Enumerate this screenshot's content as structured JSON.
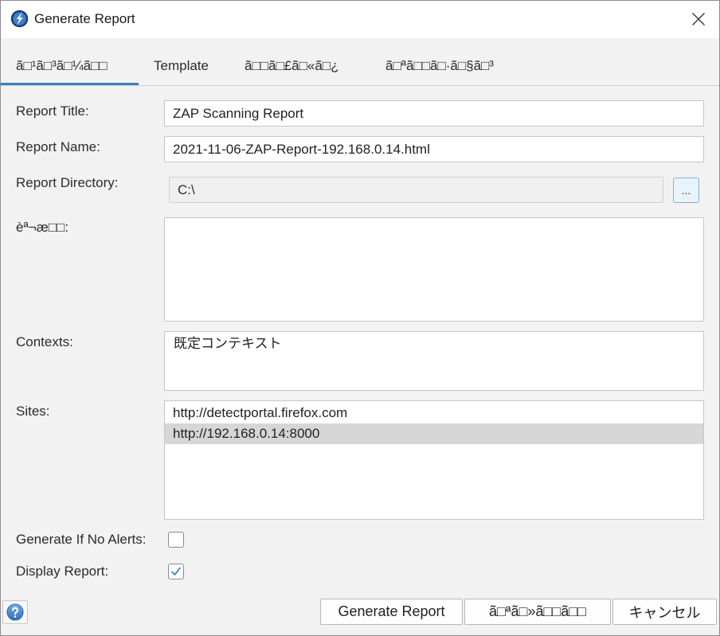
{
  "window": {
    "title": "Generate Report"
  },
  "tabs": [
    {
      "label": "ã□¹ã□³ã□¼ã□□",
      "selected": true
    },
    {
      "label": "Template",
      "selected": false
    },
    {
      "label": "ã□□ã□£ã□«ã□¿",
      "selected": false
    },
    {
      "label": "ã□ªã□□ã□·ã□§ã□³",
      "selected": false
    }
  ],
  "form": {
    "report_title": {
      "label": "Report Title:",
      "value": "ZAP Scanning Report"
    },
    "report_name": {
      "label": "Report Name:",
      "value": "2021-11-06-ZAP-Report-192.168.0.14.html"
    },
    "report_directory": {
      "label": "Report Directory:",
      "value": "C:\\",
      "browse_label": "...",
      "disabled": true
    },
    "description": {
      "label": "èª¬æ□□:"
    },
    "contexts": {
      "label": "Contexts:",
      "items": [
        "既定コンテキスト"
      ]
    },
    "sites": {
      "label": "Sites:",
      "items": [
        {
          "url": "http://detectportal.firefox.com",
          "selected": false
        },
        {
          "url": "http://192.168.0.14:8000",
          "selected": true
        }
      ]
    },
    "generate_if_no_alerts": {
      "label": "Generate If No Alerts:",
      "checked": false
    },
    "display_report": {
      "label": "Display Report:",
      "checked": true
    }
  },
  "footer": {
    "generate_label": "Generate Report",
    "reset_label": "ã□ªã□»ã□□ã□□",
    "cancel_label": "キャンセル"
  },
  "icons": {
    "app": "zap-logo-icon",
    "close": "close-icon",
    "help": "help-icon",
    "check": "checkmark-icon"
  },
  "colors": {
    "accent": "#3d7ec4",
    "selected_row": "#d6d6d6",
    "panel": "#f2f2f2",
    "titlebar": "#ffffff",
    "field_border": "#c6c6c6"
  }
}
